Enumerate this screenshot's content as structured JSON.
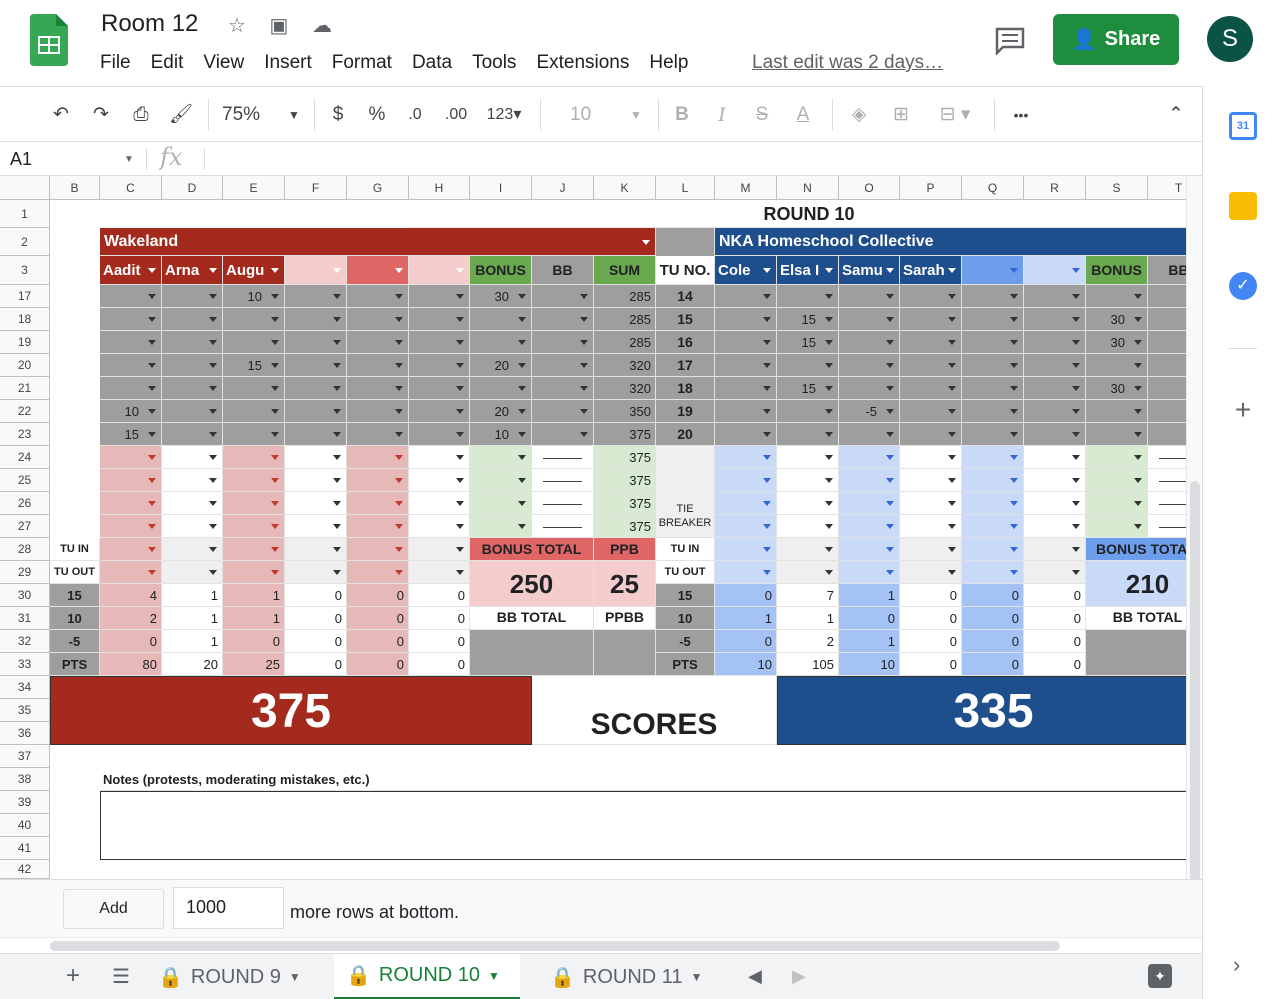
{
  "doc": {
    "title": "Room 12",
    "last_edit": "Last edit was 2 days…",
    "share": "Share",
    "avatar": "S"
  },
  "menus": [
    "File",
    "Edit",
    "View",
    "Insert",
    "Format",
    "Data",
    "Tools",
    "Extensions",
    "Help"
  ],
  "toolbar": {
    "zoom": "75%",
    "currency": "$",
    "percent": "%",
    "dec_less": ".0",
    "dec_more": ".00",
    "format": "123",
    "font_size": "10",
    "bold": "B",
    "italic": "I",
    "strike": "S",
    "text_color": "A",
    "more": "•••"
  },
  "formula": {
    "namebox": "A1",
    "fx": "fx"
  },
  "columns": [
    "B",
    "C",
    "D",
    "E",
    "F",
    "G",
    "H",
    "I",
    "J",
    "K",
    "L",
    "M",
    "N",
    "O",
    "P",
    "Q",
    "R",
    "S",
    "T"
  ],
  "rows": [
    "1",
    "2",
    "3",
    "17",
    "18",
    "19",
    "20",
    "21",
    "22",
    "23",
    "24",
    "25",
    "26",
    "27",
    "28",
    "29",
    "30",
    "31",
    "32",
    "33",
    "34",
    "35",
    "36",
    "37",
    "38",
    "39",
    "40",
    "41",
    "42"
  ],
  "sheet": {
    "round_title": "ROUND 10",
    "team1": {
      "name": "Wakeland",
      "players": [
        "Aadit",
        "Arna",
        "Augu",
        "",
        "",
        ""
      ],
      "bonus": "BONUS",
      "bb": "BB",
      "sum": "SUM",
      "tu_no": "TU NO.",
      "bonus_total_label": "BONUS TOTAL",
      "ppb_label": "PPB",
      "bonus_total": "250",
      "ppb": "25",
      "bb_total_label": "BB TOTAL",
      "ppbb_label": "PPBB",
      "score": "375"
    },
    "team2": {
      "name": "NKA Homeschool Collective",
      "players": [
        "Cole",
        "Elsa I",
        "Samu",
        "Sarah",
        "",
        ""
      ],
      "bonus": "BONUS",
      "bb": "BB",
      "bonus_total_label": "BONUS TOTA",
      "bonus_total": "210",
      "bb_total_label": "BB TOTAL",
      "score": "335"
    },
    "scores_label": "SCORES",
    "tie_breaker": "TIE BREAKER",
    "notes_label": "Notes (protests, moderating mistakes, etc.)",
    "tu_in": "TU IN",
    "tu_out": "TU OUT",
    "pts": "PTS",
    "stat_rows": [
      "15",
      "10",
      "-5"
    ],
    "dash": "———",
    "t1_rows": [
      {
        "c": "",
        "d": "",
        "e": "10",
        "f": "",
        "g": "",
        "h": "",
        "i": "30",
        "j": "",
        "k": "285",
        "l": "14"
      },
      {
        "c": "",
        "d": "",
        "e": "",
        "f": "",
        "g": "",
        "h": "",
        "i": "",
        "j": "",
        "k": "285",
        "l": "15"
      },
      {
        "c": "",
        "d": "",
        "e": "",
        "f": "",
        "g": "",
        "h": "",
        "i": "",
        "j": "",
        "k": "285",
        "l": "16"
      },
      {
        "c": "",
        "d": "",
        "e": "15",
        "f": "",
        "g": "",
        "h": "",
        "i": "20",
        "j": "",
        "k": "320",
        "l": "17"
      },
      {
        "c": "",
        "d": "",
        "e": "",
        "f": "",
        "g": "",
        "h": "",
        "i": "",
        "j": "",
        "k": "320",
        "l": "18"
      },
      {
        "c": "10",
        "d": "",
        "e": "",
        "f": "",
        "g": "",
        "h": "",
        "i": "20",
        "j": "",
        "k": "350",
        "l": "19"
      },
      {
        "c": "15",
        "d": "",
        "e": "",
        "f": "",
        "g": "",
        "h": "",
        "i": "10",
        "j": "",
        "k": "375",
        "l": "20"
      },
      {
        "c": "",
        "d": "",
        "e": "",
        "f": "",
        "g": "",
        "h": "",
        "i": "",
        "j": "",
        "k": "375",
        "l": ""
      },
      {
        "c": "",
        "d": "",
        "e": "",
        "f": "",
        "g": "",
        "h": "",
        "i": "",
        "j": "",
        "k": "375",
        "l": ""
      },
      {
        "c": "",
        "d": "",
        "e": "",
        "f": "",
        "g": "",
        "h": "",
        "i": "",
        "j": "",
        "k": "375",
        "l": ""
      },
      {
        "c": "",
        "d": "",
        "e": "",
        "f": "",
        "g": "",
        "h": "",
        "i": "",
        "j": "",
        "k": "375",
        "l": ""
      }
    ],
    "t2_rows": [
      {
        "m": "",
        "n": "",
        "o": "",
        "p": "",
        "q": "",
        "r": "",
        "s": ""
      },
      {
        "m": "",
        "n": "15",
        "o": "",
        "p": "",
        "q": "",
        "r": "",
        "s": "30"
      },
      {
        "m": "",
        "n": "15",
        "o": "",
        "p": "",
        "q": "",
        "r": "",
        "s": "30"
      },
      {
        "m": "",
        "n": "",
        "o": "",
        "p": "",
        "q": "",
        "r": "",
        "s": ""
      },
      {
        "m": "",
        "n": "15",
        "o": "",
        "p": "",
        "q": "",
        "r": "",
        "s": "30"
      },
      {
        "m": "",
        "n": "",
        "o": "-5",
        "p": "",
        "q": "",
        "r": "",
        "s": ""
      },
      {
        "m": "",
        "n": "",
        "o": "",
        "p": "",
        "q": "",
        "r": "",
        "s": ""
      },
      {
        "m": "",
        "n": "",
        "o": "",
        "p": "",
        "q": "",
        "r": "",
        "s": ""
      },
      {
        "m": "",
        "n": "",
        "o": "",
        "p": "",
        "q": "",
        "r": "",
        "s": ""
      },
      {
        "m": "",
        "n": "",
        "o": "",
        "p": "",
        "q": "",
        "r": "",
        "s": ""
      },
      {
        "m": "",
        "n": "",
        "o": "",
        "p": "",
        "q": "",
        "r": "",
        "s": ""
      }
    ],
    "t1_stats": [
      [
        "4",
        "1",
        "1",
        "0",
        "0",
        "0"
      ],
      [
        "2",
        "1",
        "1",
        "0",
        "0",
        "0"
      ],
      [
        "0",
        "1",
        "0",
        "0",
        "0",
        "0"
      ],
      [
        "80",
        "20",
        "25",
        "0",
        "0",
        "0"
      ]
    ],
    "t2_stats": [
      [
        "0",
        "7",
        "1",
        "0",
        "0",
        "0"
      ],
      [
        "1",
        "1",
        "0",
        "0",
        "0",
        "0"
      ],
      [
        "0",
        "2",
        "1",
        "0",
        "0",
        "0"
      ],
      [
        "10",
        "105",
        "10",
        "0",
        "0",
        "0"
      ]
    ]
  },
  "addbar": {
    "add": "Add",
    "count": "1000",
    "text": "more rows at bottom."
  },
  "tabs": [
    "ROUND 9",
    "ROUND 10",
    "ROUND 11"
  ],
  "colors": {
    "red": "#a32a1c",
    "blue": "#1f4e8c",
    "green": "#6aa84f",
    "grey": "#999999",
    "pink": "#e8b4b4",
    "lightblue": "#b7c9f0"
  }
}
